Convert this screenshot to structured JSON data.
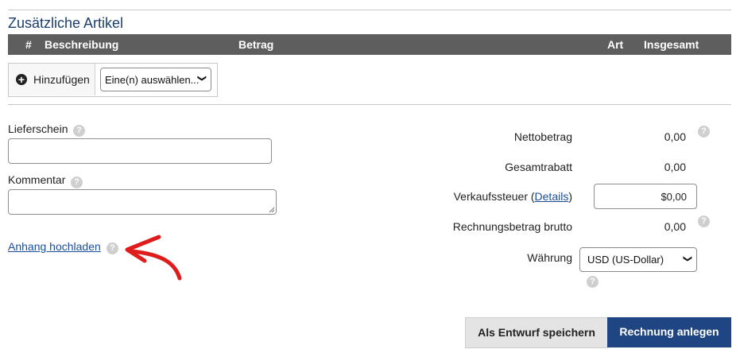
{
  "section": {
    "title": "Zusätzliche Artikel"
  },
  "table": {
    "columns": {
      "num": "#",
      "description": "Beschreibung",
      "amount": "Betrag",
      "type": "Art",
      "total": "Insgesamt"
    }
  },
  "add_bar": {
    "add_label": "Hinzufügen",
    "select_value": "Eine(n) auswählen..."
  },
  "form": {
    "delivery_note_label": "Lieferschein",
    "delivery_note_value": "",
    "comment_label": "Kommentar",
    "comment_value": "",
    "upload_link": "Anhang hochladen"
  },
  "summary": {
    "net_label": "Nettobetrag",
    "net_value": "0,00",
    "discount_label": "Gesamtrabatt",
    "discount_value": "0,00",
    "tax_label_prefix": "Verkaufssteuer (",
    "tax_details_link": "Details",
    "tax_label_suffix": ")",
    "tax_value": "$0,00",
    "gross_label": "Rechnungsbetrag brutto",
    "gross_value": "0,00",
    "currency_label": "Währung",
    "currency_value": "USD (US-Dollar)"
  },
  "actions": {
    "draft_label": "Als Entwurf speichern",
    "create_label": "Rechnung anlegen"
  },
  "icons": {
    "help": "?",
    "chevron": "❯",
    "plus": "+"
  },
  "colors": {
    "primary": "#1f4582",
    "header_bg": "#5e5e5e",
    "arrow": "#e01b1b",
    "title": "#1c3f6e"
  }
}
